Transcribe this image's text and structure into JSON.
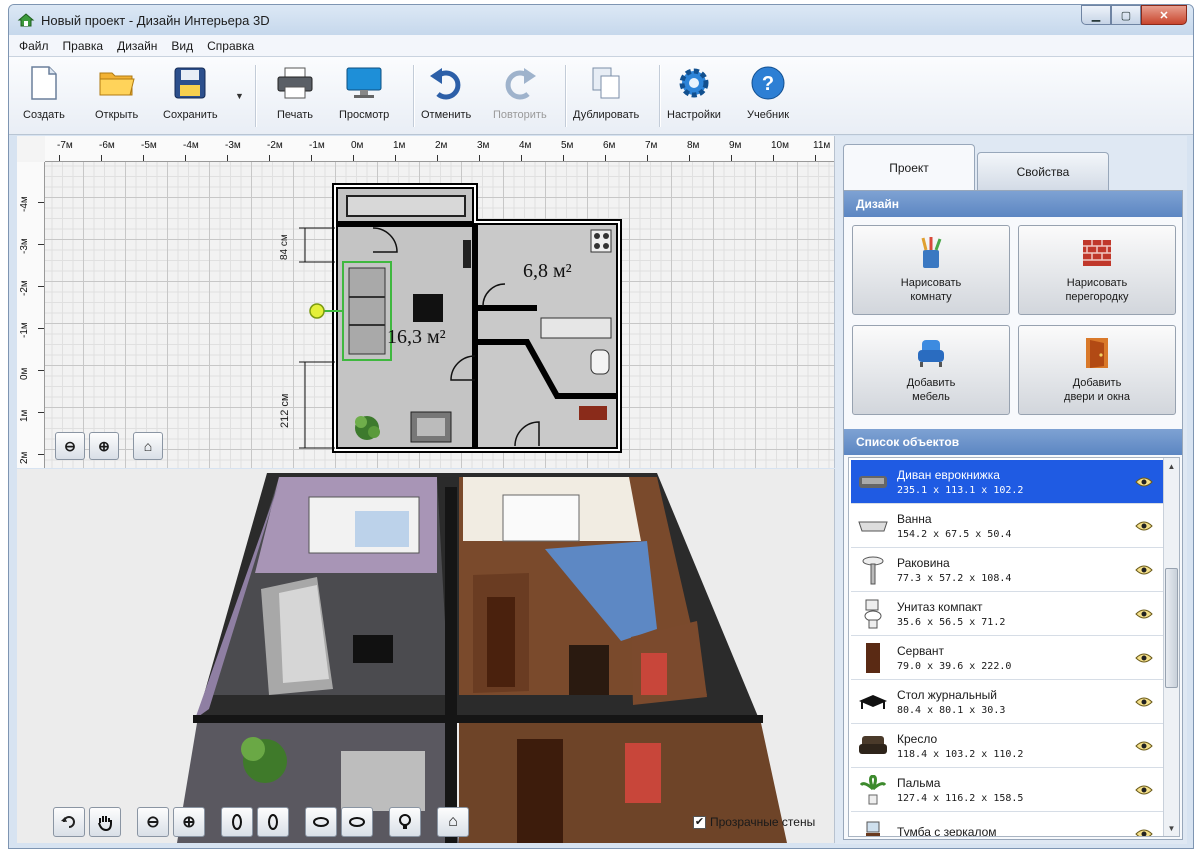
{
  "window": {
    "title": "Новый проект - Дизайн Интерьера 3D"
  },
  "menu": [
    "Файл",
    "Правка",
    "Дизайн",
    "Вид",
    "Справка"
  ],
  "toolbar": {
    "create": "Создать",
    "open": "Открыть",
    "save": "Сохранить",
    "print": "Печать",
    "preview": "Просмотр",
    "undo": "Отменить",
    "redo": "Повторить",
    "duplicate": "Дублировать",
    "settings": "Настройки",
    "tutorial": "Учебник"
  },
  "plan": {
    "ruler_top": [
      "-7м",
      "-6м",
      "-5м",
      "-4м",
      "-3м",
      "-2м",
      "-1м",
      "0м",
      "1м",
      "2м",
      "3м",
      "4м",
      "5м",
      "6м",
      "7м",
      "8м",
      "9м",
      "10м",
      "11м"
    ],
    "ruler_left": [
      "-4м",
      "-3м",
      "-2м",
      "-1м",
      "0м",
      "1м",
      "2м"
    ],
    "room_large_area": "16,3 м²",
    "room_small_area": "6,8 м²",
    "dim_top": "84 см",
    "dim_side": "212 см"
  },
  "view3d": {
    "transparent_walls": "Прозрачные стены",
    "transparent_walls_checked": true
  },
  "panel": {
    "tab_project": "Проект",
    "tab_properties": "Свойства",
    "design_header": "Дизайн",
    "draw_room": "Нарисовать\nкомнату",
    "draw_partition": "Нарисовать\nперегородку",
    "add_furniture": "Добавить\nмебель",
    "add_doors": "Добавить\nдвери и окна",
    "objects_header": "Список объектов"
  },
  "objects": [
    {
      "name": "Диван еврокнижка",
      "dims": "235.1 x 113.1 x 102.2",
      "icon": "sofa-icon"
    },
    {
      "name": "Ванна",
      "dims": "154.2 x 67.5 x 50.4",
      "icon": "bathtub-icon"
    },
    {
      "name": "Раковина",
      "dims": "77.3 x 57.2 x 108.4",
      "icon": "sink-icon"
    },
    {
      "name": "Унитаз компакт",
      "dims": "35.6 x 56.5 x 71.2",
      "icon": "toilet-icon"
    },
    {
      "name": "Сервант",
      "dims": "79.0 x 39.6 x 222.0",
      "icon": "cabinet-icon"
    },
    {
      "name": "Стол журнальный",
      "dims": "80.4 x 80.1 x 30.3",
      "icon": "table-icon"
    },
    {
      "name": "Кресло",
      "dims": "118.4 x 103.2 x 110.2",
      "icon": "armchair-icon"
    },
    {
      "name": "Пальма",
      "dims": "127.4 x 116.2 x 158.5",
      "icon": "palm-icon"
    },
    {
      "name": "Тумба с зеркалом",
      "dims": "",
      "icon": "dresser-icon"
    }
  ],
  "colors": {
    "selected": "#1f5be3",
    "header": "#5c86c2",
    "wall": "#000000",
    "floor": "#c8c8c8"
  }
}
